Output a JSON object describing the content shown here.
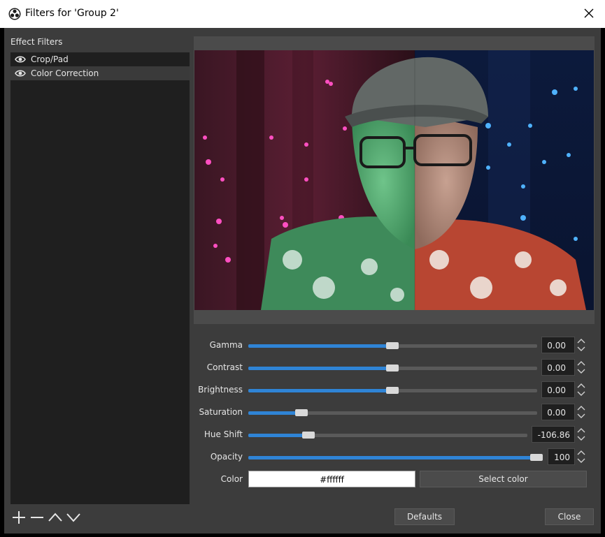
{
  "window": {
    "title": "Filters for 'Group 2'"
  },
  "filters": {
    "section_label": "Effect Filters",
    "items": [
      {
        "label": "Crop/Pad",
        "selected": false
      },
      {
        "label": "Color Correction",
        "selected": true
      }
    ]
  },
  "properties": {
    "gamma": {
      "label": "Gamma",
      "value": "0.00",
      "fraction": 0.5
    },
    "contrast": {
      "label": "Contrast",
      "value": "0.00",
      "fraction": 0.5
    },
    "brightness": {
      "label": "Brightness",
      "value": "0.00",
      "fraction": 0.5
    },
    "saturation": {
      "label": "Saturation",
      "value": "0.00",
      "fraction": 0.18
    },
    "hue_shift": {
      "label": "Hue Shift",
      "value": "-106.86",
      "fraction": 0.21
    },
    "opacity": {
      "label": "Opacity",
      "value": "100",
      "fraction": 1.0
    },
    "color": {
      "label": "Color",
      "value": "#ffffff",
      "button_label": "Select color"
    }
  },
  "buttons": {
    "defaults": "Defaults",
    "close": "Close"
  },
  "colors": {
    "accent": "#2f84d6",
    "panel": "#3c3c3c",
    "list_bg": "#1f1f1f",
    "selection": "#3a3a3a"
  },
  "icons": [
    "obs-logo-icon",
    "close-icon",
    "eye-icon",
    "add-icon",
    "remove-icon",
    "move-up-icon",
    "move-down-icon",
    "spin-up-icon",
    "spin-down-icon"
  ]
}
